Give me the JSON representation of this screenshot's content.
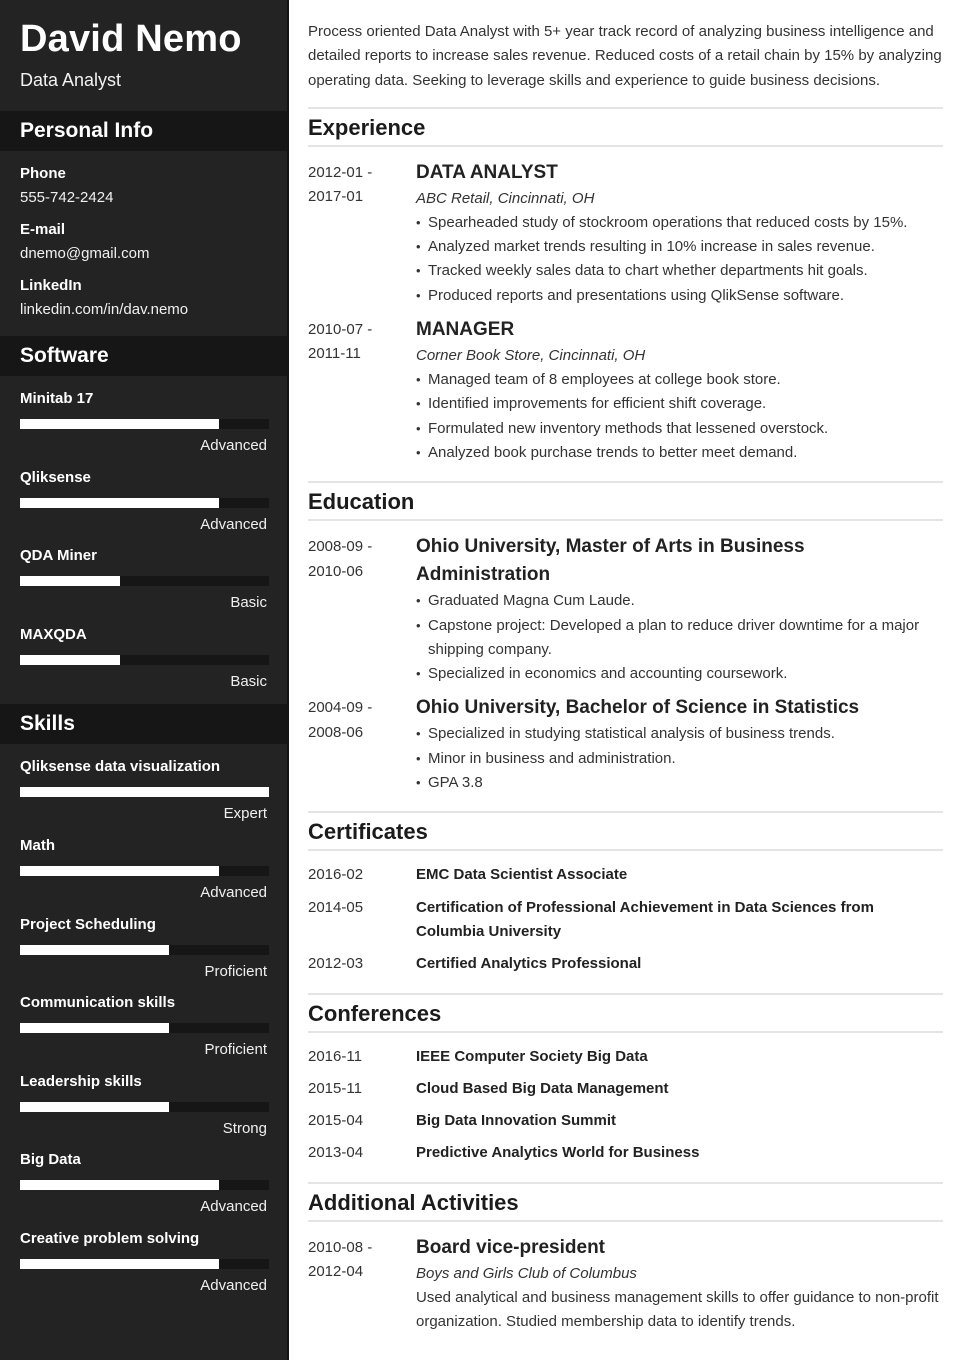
{
  "header": {
    "name": "David Nemo",
    "role": "Data Analyst"
  },
  "sidebar": {
    "personal_info": {
      "heading": "Personal Info",
      "items": [
        {
          "label": "Phone",
          "value": "555-742-2424"
        },
        {
          "label": "E-mail",
          "value": "dnemo@gmail.com"
        },
        {
          "label": "LinkedIn",
          "value": "linkedin.com/in/dav.nemo"
        }
      ]
    },
    "software": {
      "heading": "Software",
      "items": [
        {
          "name": "Minitab 17",
          "level": "Advanced",
          "fill_percent": 80
        },
        {
          "name": "Qliksense",
          "level": "Advanced",
          "fill_percent": 80
        },
        {
          "name": "QDA Miner",
          "level": "Basic",
          "fill_percent": 40
        },
        {
          "name": "MAXQDA",
          "level": "Basic",
          "fill_percent": 40
        }
      ]
    },
    "skills": {
      "heading": "Skills",
      "items": [
        {
          "name": "Qliksense data visualization",
          "level": "Expert",
          "fill_percent": 100
        },
        {
          "name": "Math",
          "level": "Advanced",
          "fill_percent": 80
        },
        {
          "name": "Project Scheduling",
          "level": "Proficient",
          "fill_percent": 60
        },
        {
          "name": "Communication skills",
          "level": "Proficient",
          "fill_percent": 60
        },
        {
          "name": "Leadership skills",
          "level": "Strong",
          "fill_percent": 60
        },
        {
          "name": "Big Data",
          "level": "Advanced",
          "fill_percent": 80
        },
        {
          "name": "Creative problem solving",
          "level": "Advanced",
          "fill_percent": 80
        }
      ]
    }
  },
  "main": {
    "summary": "Process oriented Data Analyst with 5+ year track record of analyzing business intelligence and detailed reports to increase sales revenue. Reduced costs of a retail chain by 15% by analyzing operating data. Seeking to leverage skills and experience to guide business decisions.",
    "experience": {
      "heading": "Experience",
      "entries": [
        {
          "date_start": "2012-01 -",
          "date_end": "2017-01",
          "title": "DATA ANALYST",
          "subtitle": "ABC Retail, Cincinnati, OH",
          "bullets": [
            "Spearheaded study of stockroom operations that reduced costs by 15%.",
            "Analyzed market trends resulting in 10% increase in sales revenue.",
            "Tracked weekly sales data to chart whether departments hit goals.",
            "Produced reports and presentations using QlikSense software."
          ]
        },
        {
          "date_start": "2010-07 -",
          "date_end": "2011-11",
          "title": "MANAGER",
          "subtitle": "Corner Book Store, Cincinnati, OH",
          "bullets": [
            "Managed team of 8 employees at college book store.",
            "Identified improvements for efficient shift coverage.",
            "Formulated new inventory methods that lessened overstock.",
            "Analyzed book purchase trends to better meet demand."
          ]
        }
      ]
    },
    "education": {
      "heading": "Education",
      "entries": [
        {
          "date_start": "2008-09 -",
          "date_end": "2010-06",
          "title": "Ohio University, Master of Arts in Business Administration",
          "bullets": [
            "Graduated Magna Cum Laude.",
            "Capstone project: Developed a plan to reduce driver downtime for a major shipping company.",
            "Specialized in economics and accounting coursework."
          ]
        },
        {
          "date_start": "2004-09 -",
          "date_end": "2008-06",
          "title": "Ohio University, Bachelor of Science in Statistics",
          "bullets": [
            "Specialized in studying statistical analysis of business trends.",
            "Minor in business and administration.",
            "GPA 3.8"
          ]
        }
      ]
    },
    "certificates": {
      "heading": "Certificates",
      "entries": [
        {
          "date": "2016-02",
          "title": "EMC Data Scientist Associate"
        },
        {
          "date": "2014-05",
          "title": "Certification of Professional Achievement in Data Sciences from Columbia University"
        },
        {
          "date": "2012-03",
          "title": "Certified Analytics Professional"
        }
      ]
    },
    "conferences": {
      "heading": "Conferences",
      "entries": [
        {
          "date": "2016-11",
          "title": "IEEE Computer Society Big Data"
        },
        {
          "date": "2015-11",
          "title": "Cloud Based Big Data Management"
        },
        {
          "date": "2015-04",
          "title": "Big Data Innovation Summit"
        },
        {
          "date": "2013-04",
          "title": "Predictive Analytics World for Business"
        }
      ]
    },
    "activities": {
      "heading": "Additional Activities",
      "entries": [
        {
          "date_start": "2010-08 -",
          "date_end": "2012-04",
          "title": "Board vice-president",
          "subtitle": "Boys and Girls Club of Columbus",
          "description": "Used analytical and business management skills to offer guidance to non-profit organization. Studied membership data to identify trends."
        }
      ]
    }
  }
}
